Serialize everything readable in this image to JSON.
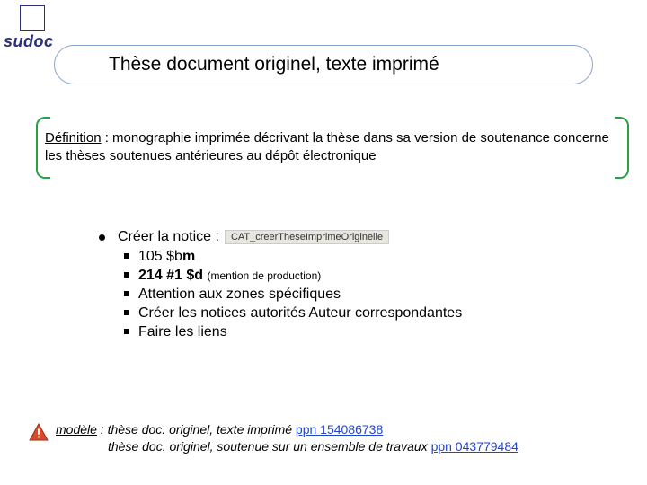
{
  "logo": {
    "text": "sudoc"
  },
  "title": "Thèse document originel, texte imprimé",
  "definition": {
    "label": "Définition",
    "text": " : monographie imprimée décrivant la thèse dans sa version de soutenance concerne les thèses soutenues antérieures au dépôt électronique"
  },
  "createNotice": {
    "heading": "Créer la notice :",
    "badge": "CAT_creerTheseImprimeOriginelle",
    "items": [
      {
        "code": "105 $b",
        "codeBold": "m",
        "note": ""
      },
      {
        "code": "214 #1 $d",
        "codeBold": "",
        "note": "(mention de production)"
      },
      {
        "plain": "Attention aux zones spécifiques"
      },
      {
        "plain": "Créer les notices autorités Auteur correspondantes"
      },
      {
        "plain": "Faire les liens"
      }
    ]
  },
  "footer": {
    "label": "modèle",
    "line1_text": " : thèse doc. originel, texte imprimé ",
    "line1_link": "ppn 154086738",
    "line2_text": "thèse doc. originel, soutenue sur un ensemble de travaux ",
    "line2_link": "ppn 043779484"
  }
}
